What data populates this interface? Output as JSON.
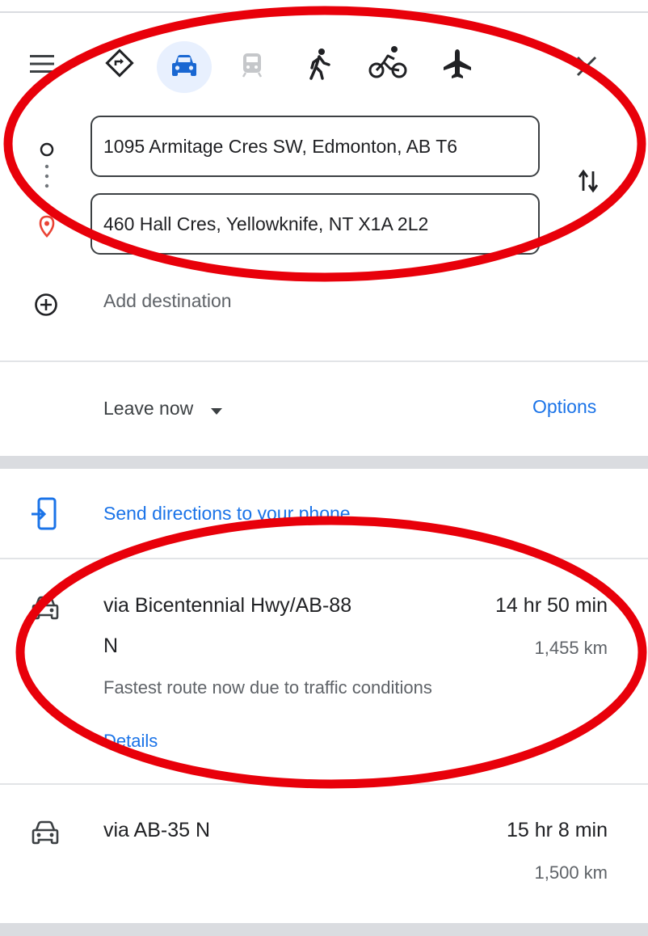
{
  "travel_modes": [
    {
      "icon": "directions-diamond-icon",
      "label": "Best travel mode"
    },
    {
      "icon": "car-icon",
      "label": "Driving",
      "selected": true
    },
    {
      "icon": "transit-icon",
      "label": "Transit"
    },
    {
      "icon": "walk-icon",
      "label": "Walking"
    },
    {
      "icon": "bicycle-icon",
      "label": "Cycling"
    },
    {
      "icon": "flight-icon",
      "label": "Flights"
    }
  ],
  "origin": {
    "value": "1095 Armitage Cres SW, Edmonton, AB T6"
  },
  "destination": {
    "value": "460 Hall Cres, Yellowknife, NT X1A 2L2"
  },
  "add_destination_label": "Add destination",
  "leave_now_label": "Leave now",
  "options_label": "Options",
  "send_to_phone_label": "Send directions to your phone",
  "routes": [
    {
      "name_line1": "via Bicentennial Hwy/AB-88",
      "name_line2": "N",
      "duration": "14 hr 50 min",
      "distance": "1,455 km",
      "note": "Fastest route now due to traffic conditions",
      "details_label": "Details"
    },
    {
      "name_line1": "via AB-35 N",
      "duration": "15 hr 8 min",
      "distance": "1,500 km"
    }
  ],
  "colors": {
    "accent_blue": "#1a73e8",
    "annotation_red": "#e8000a",
    "destination_pin": "#ea4335",
    "text_grey": "#5f6368"
  }
}
